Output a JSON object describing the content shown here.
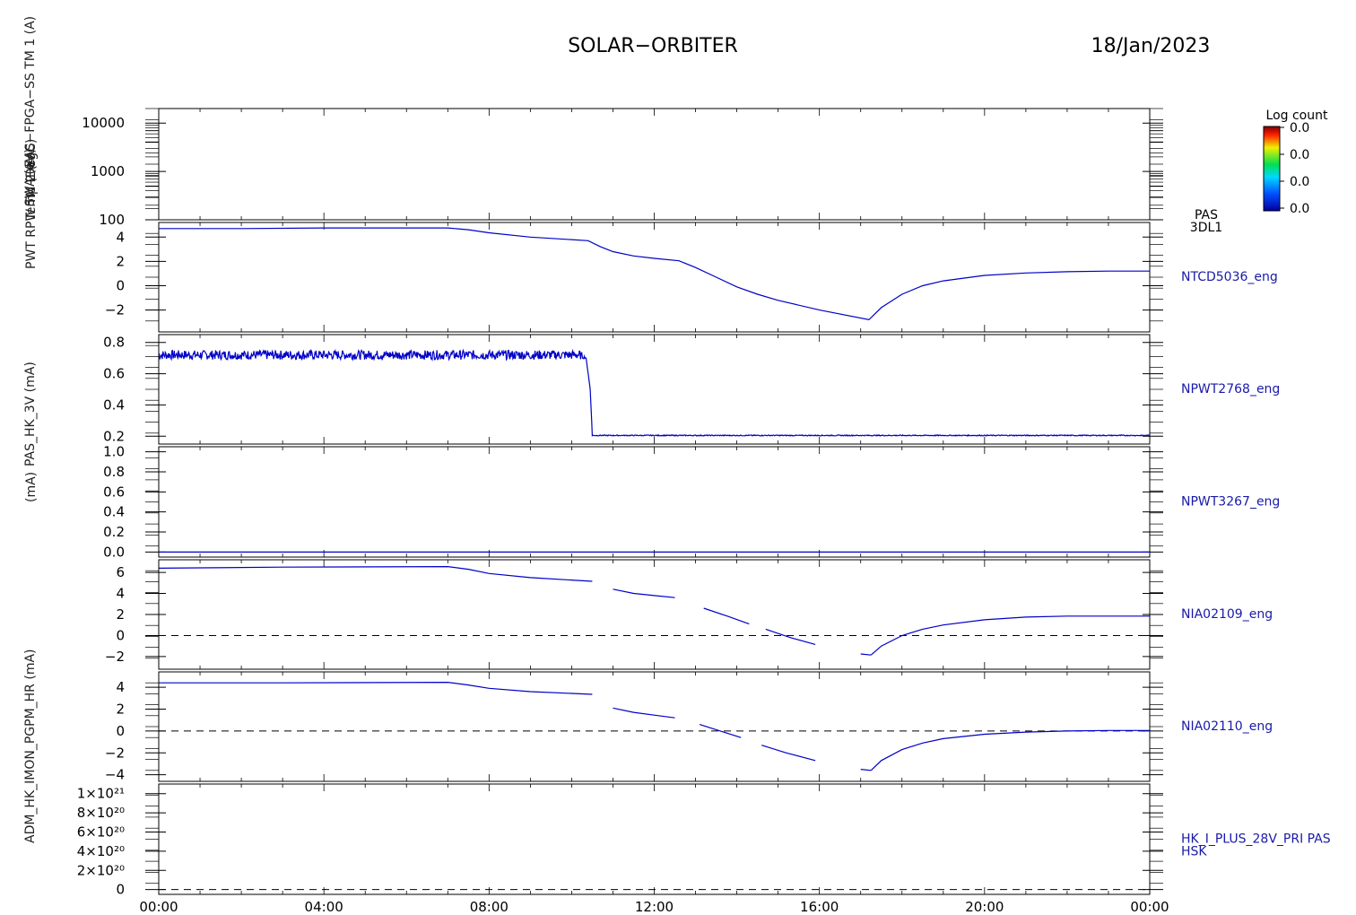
{
  "header": {
    "title": "SOLAR−ORBITER",
    "date": "18/Jan/2023"
  },
  "colorbar": {
    "label": "Log count",
    "ticks": [
      "0.0",
      "0.0",
      "0.0",
      "0.0"
    ],
    "instrument": [
      "PAS",
      "3DL1"
    ]
  },
  "y_axis_stack_labels": [
    "(eV)",
    "Temp (DegC)",
    "SWA−EAS−FPGA−SS TM 1 (A)",
    "PWT RPW TM 2 (A)",
    "PAS_HK_3V (mA)",
    "(mA)",
    "ADM_HK_IMON_PGPM_HR (mA)"
  ],
  "time_axis": [
    "00:00",
    "04:00",
    "08:00",
    "12:00",
    "16:00",
    "20:00",
    "00:00"
  ],
  "chart_data": [
    {
      "type": "heatmap",
      "panel": "PAS 3DL1 energy spectrogram",
      "ylabel": "(eV)",
      "yscale": "log",
      "ylim": [
        100,
        20000
      ],
      "yticks": [
        "10000",
        "1000",
        "100"
      ],
      "ytick_values": [
        10000,
        1000,
        100
      ],
      "values": []
    },
    {
      "type": "line",
      "name": "NTCD5036_eng",
      "ylim": [
        -3.8,
        5.2
      ],
      "yticks": [
        "4",
        "2",
        "0",
        "−2"
      ],
      "ytick_values": [
        4,
        2,
        0,
        -2
      ],
      "x": [
        0,
        2,
        4,
        7,
        7.5,
        8,
        9,
        10.4,
        10.7,
        11,
        11.5,
        12,
        12.6,
        13,
        13.5,
        14,
        14.5,
        15,
        16,
        17.2,
        17.5,
        18,
        18.5,
        19,
        20,
        21,
        22,
        23,
        24
      ],
      "y": [
        4.7,
        4.7,
        4.75,
        4.75,
        4.6,
        4.35,
        4.0,
        3.7,
        3.2,
        2.8,
        2.45,
        2.25,
        2.05,
        1.5,
        0.7,
        -0.1,
        -0.7,
        -1.2,
        -2.0,
        -2.8,
        -1.8,
        -0.7,
        0.0,
        0.4,
        0.85,
        1.05,
        1.15,
        1.2,
        1.2
      ]
    },
    {
      "type": "line",
      "name": "NPWT2768_eng",
      "ylim": [
        0.15,
        0.85
      ],
      "yticks": [
        "0.8",
        "0.6",
        "0.4",
        "0.2"
      ],
      "ytick_values": [
        0.8,
        0.6,
        0.4,
        0.2
      ],
      "x": [
        0,
        10.2,
        10.35,
        10.45,
        10.5,
        24
      ],
      "y": [
        0.72,
        0.72,
        0.7,
        0.5,
        0.205,
        0.205
      ],
      "noise": [
        0.03,
        0.03,
        0,
        0,
        0.003,
        0.003
      ]
    },
    {
      "type": "line",
      "name": "NPWT3267_eng",
      "ylim": [
        -0.05,
        1.05
      ],
      "yticks": [
        "1.0",
        "0.8",
        "0.6",
        "0.4",
        "0.2",
        "0.0"
      ],
      "ytick_values": [
        1.0,
        0.8,
        0.6,
        0.4,
        0.2,
        0.0
      ],
      "x": [
        0,
        24
      ],
      "y": [
        0.0,
        0.0
      ]
    },
    {
      "type": "line",
      "name": "NIA02109_eng",
      "ylim": [
        -3.2,
        7.2
      ],
      "yticks": [
        "6",
        "4",
        "2",
        "0",
        "−2"
      ],
      "ytick_values": [
        6,
        4,
        2,
        0,
        -2
      ],
      "reference_line": 0,
      "segments": [
        {
          "x": [
            0,
            3,
            7,
            7.5,
            8,
            9,
            10.5
          ],
          "y": [
            6.4,
            6.5,
            6.55,
            6.3,
            5.9,
            5.5,
            5.15
          ]
        },
        {
          "x": [
            11,
            11.5,
            12,
            12.5
          ],
          "y": [
            4.4,
            4.0,
            3.8,
            3.6
          ]
        },
        {
          "x": [
            13.2,
            13.8,
            14.3
          ],
          "y": [
            2.6,
            1.8,
            1.1
          ]
        },
        {
          "x": [
            14.7,
            15.3,
            15.9
          ],
          "y": [
            0.6,
            -0.2,
            -0.85
          ]
        },
        {
          "x": [
            17.0,
            17.25
          ],
          "y": [
            -1.75,
            -1.85
          ]
        },
        {
          "x": [
            17.25,
            17.5,
            18,
            18.5,
            19,
            20,
            21,
            22,
            23,
            24
          ],
          "y": [
            -1.85,
            -1.0,
            0.0,
            0.6,
            1.0,
            1.5,
            1.75,
            1.85,
            1.85,
            1.85
          ]
        }
      ]
    },
    {
      "type": "line",
      "name": "NIA02110_eng",
      "ylim": [
        -4.6,
        5.4
      ],
      "yticks": [
        "4",
        "2",
        "0",
        "−2",
        "−4"
      ],
      "ytick_values": [
        4,
        2,
        0,
        -2,
        -4
      ],
      "reference_line": 0,
      "segments": [
        {
          "x": [
            0,
            3,
            7,
            7.5,
            8,
            9,
            10.5
          ],
          "y": [
            4.4,
            4.4,
            4.45,
            4.2,
            3.9,
            3.6,
            3.35
          ]
        },
        {
          "x": [
            11,
            11.5,
            12,
            12.5
          ],
          "y": [
            2.1,
            1.7,
            1.45,
            1.2
          ]
        },
        {
          "x": [
            13.1,
            13.6,
            14.1
          ],
          "y": [
            0.6,
            0.0,
            -0.6
          ]
        },
        {
          "x": [
            14.6,
            15.2,
            15.9
          ],
          "y": [
            -1.3,
            -2.0,
            -2.7
          ]
        },
        {
          "x": [
            17.0,
            17.25
          ],
          "y": [
            -3.5,
            -3.6
          ]
        },
        {
          "x": [
            17.25,
            17.5,
            18,
            18.5,
            19,
            20,
            21,
            22,
            23,
            24
          ],
          "y": [
            -3.6,
            -2.7,
            -1.7,
            -1.1,
            -0.7,
            -0.3,
            -0.1,
            0.0,
            0.05,
            0.05
          ]
        }
      ]
    },
    {
      "type": "line",
      "name": "HK_I_PLUS_28V_PRI PAS HSK",
      "ylim": [
        -5e+19,
        1.1e+21
      ],
      "yticks": [
        "1×10²¹",
        "8×10²⁰",
        "6×10²⁰",
        "4×10²⁰",
        "2×10²⁰",
        "0"
      ],
      "ytick_values": [
        1e+21,
        8e+20,
        6e+20,
        4e+20,
        2e+20,
        0
      ],
      "reference_line": 0,
      "x": [],
      "y": []
    }
  ],
  "panel_labels": [
    [
      "PAS",
      "3DL1"
    ],
    [
      "NTCD5036_eng"
    ],
    [
      "NPWT2768_eng"
    ],
    [
      "NPWT3267_eng"
    ],
    [
      "NIA02109_eng"
    ],
    [
      "NIA02110_eng"
    ],
    [
      "HK_I_PLUS_28V_PRI PAS",
      "HSK"
    ]
  ],
  "colors": {
    "series": "#0000c8",
    "label": "#1a1aa8",
    "axis": "#000000"
  }
}
